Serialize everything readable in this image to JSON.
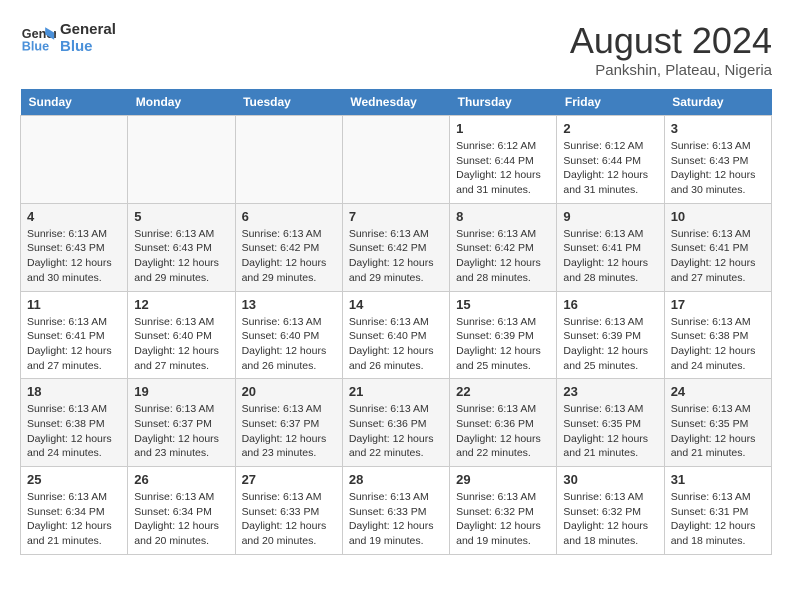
{
  "logo": {
    "line1": "General",
    "line2": "Blue"
  },
  "title": "August 2024",
  "subtitle": "Pankshin, Plateau, Nigeria",
  "weekdays": [
    "Sunday",
    "Monday",
    "Tuesday",
    "Wednesday",
    "Thursday",
    "Friday",
    "Saturday"
  ],
  "weeks": [
    [
      {
        "day": "",
        "info": ""
      },
      {
        "day": "",
        "info": ""
      },
      {
        "day": "",
        "info": ""
      },
      {
        "day": "",
        "info": ""
      },
      {
        "day": "1",
        "info": "Sunrise: 6:12 AM\nSunset: 6:44 PM\nDaylight: 12 hours\nand 31 minutes."
      },
      {
        "day": "2",
        "info": "Sunrise: 6:12 AM\nSunset: 6:44 PM\nDaylight: 12 hours\nand 31 minutes."
      },
      {
        "day": "3",
        "info": "Sunrise: 6:13 AM\nSunset: 6:43 PM\nDaylight: 12 hours\nand 30 minutes."
      }
    ],
    [
      {
        "day": "4",
        "info": "Sunrise: 6:13 AM\nSunset: 6:43 PM\nDaylight: 12 hours\nand 30 minutes."
      },
      {
        "day": "5",
        "info": "Sunrise: 6:13 AM\nSunset: 6:43 PM\nDaylight: 12 hours\nand 29 minutes."
      },
      {
        "day": "6",
        "info": "Sunrise: 6:13 AM\nSunset: 6:42 PM\nDaylight: 12 hours\nand 29 minutes."
      },
      {
        "day": "7",
        "info": "Sunrise: 6:13 AM\nSunset: 6:42 PM\nDaylight: 12 hours\nand 29 minutes."
      },
      {
        "day": "8",
        "info": "Sunrise: 6:13 AM\nSunset: 6:42 PM\nDaylight: 12 hours\nand 28 minutes."
      },
      {
        "day": "9",
        "info": "Sunrise: 6:13 AM\nSunset: 6:41 PM\nDaylight: 12 hours\nand 28 minutes."
      },
      {
        "day": "10",
        "info": "Sunrise: 6:13 AM\nSunset: 6:41 PM\nDaylight: 12 hours\nand 27 minutes."
      }
    ],
    [
      {
        "day": "11",
        "info": "Sunrise: 6:13 AM\nSunset: 6:41 PM\nDaylight: 12 hours\nand 27 minutes."
      },
      {
        "day": "12",
        "info": "Sunrise: 6:13 AM\nSunset: 6:40 PM\nDaylight: 12 hours\nand 27 minutes."
      },
      {
        "day": "13",
        "info": "Sunrise: 6:13 AM\nSunset: 6:40 PM\nDaylight: 12 hours\nand 26 minutes."
      },
      {
        "day": "14",
        "info": "Sunrise: 6:13 AM\nSunset: 6:40 PM\nDaylight: 12 hours\nand 26 minutes."
      },
      {
        "day": "15",
        "info": "Sunrise: 6:13 AM\nSunset: 6:39 PM\nDaylight: 12 hours\nand 25 minutes."
      },
      {
        "day": "16",
        "info": "Sunrise: 6:13 AM\nSunset: 6:39 PM\nDaylight: 12 hours\nand 25 minutes."
      },
      {
        "day": "17",
        "info": "Sunrise: 6:13 AM\nSunset: 6:38 PM\nDaylight: 12 hours\nand 24 minutes."
      }
    ],
    [
      {
        "day": "18",
        "info": "Sunrise: 6:13 AM\nSunset: 6:38 PM\nDaylight: 12 hours\nand 24 minutes."
      },
      {
        "day": "19",
        "info": "Sunrise: 6:13 AM\nSunset: 6:37 PM\nDaylight: 12 hours\nand 23 minutes."
      },
      {
        "day": "20",
        "info": "Sunrise: 6:13 AM\nSunset: 6:37 PM\nDaylight: 12 hours\nand 23 minutes."
      },
      {
        "day": "21",
        "info": "Sunrise: 6:13 AM\nSunset: 6:36 PM\nDaylight: 12 hours\nand 22 minutes."
      },
      {
        "day": "22",
        "info": "Sunrise: 6:13 AM\nSunset: 6:36 PM\nDaylight: 12 hours\nand 22 minutes."
      },
      {
        "day": "23",
        "info": "Sunrise: 6:13 AM\nSunset: 6:35 PM\nDaylight: 12 hours\nand 21 minutes."
      },
      {
        "day": "24",
        "info": "Sunrise: 6:13 AM\nSunset: 6:35 PM\nDaylight: 12 hours\nand 21 minutes."
      }
    ],
    [
      {
        "day": "25",
        "info": "Sunrise: 6:13 AM\nSunset: 6:34 PM\nDaylight: 12 hours\nand 21 minutes."
      },
      {
        "day": "26",
        "info": "Sunrise: 6:13 AM\nSunset: 6:34 PM\nDaylight: 12 hours\nand 20 minutes."
      },
      {
        "day": "27",
        "info": "Sunrise: 6:13 AM\nSunset: 6:33 PM\nDaylight: 12 hours\nand 20 minutes."
      },
      {
        "day": "28",
        "info": "Sunrise: 6:13 AM\nSunset: 6:33 PM\nDaylight: 12 hours\nand 19 minutes."
      },
      {
        "day": "29",
        "info": "Sunrise: 6:13 AM\nSunset: 6:32 PM\nDaylight: 12 hours\nand 19 minutes."
      },
      {
        "day": "30",
        "info": "Sunrise: 6:13 AM\nSunset: 6:32 PM\nDaylight: 12 hours\nand 18 minutes."
      },
      {
        "day": "31",
        "info": "Sunrise: 6:13 AM\nSunset: 6:31 PM\nDaylight: 12 hours\nand 18 minutes."
      }
    ]
  ]
}
